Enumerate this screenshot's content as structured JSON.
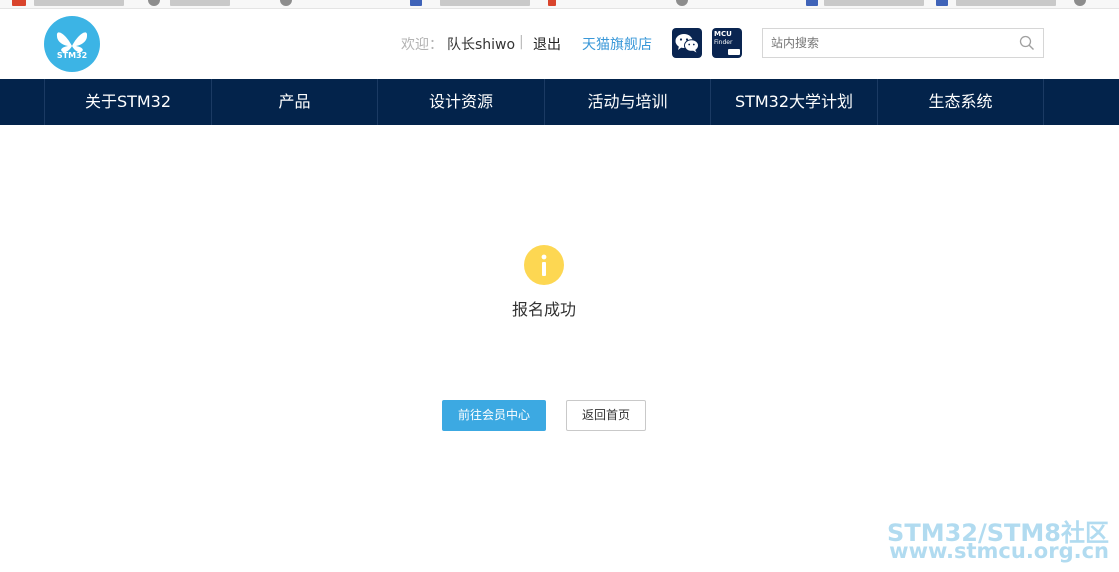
{
  "header": {
    "logo_text": "STM32",
    "welcome_label": "欢迎：",
    "username": "队长shiwo",
    "separator": "|",
    "logout_label": "退出",
    "tmall_label": "天猫旗舰店",
    "mcu_finder": {
      "line1": "MCU",
      "line2": "Finder"
    },
    "search": {
      "placeholder": "站内搜索",
      "value": ""
    }
  },
  "nav": {
    "items": [
      {
        "label": "关于STM32"
      },
      {
        "label": "产品"
      },
      {
        "label": "设计资源"
      },
      {
        "label": "活动与培训"
      },
      {
        "label": "STM32大学计划"
      },
      {
        "label": "生态系统"
      }
    ]
  },
  "main": {
    "message": "报名成功",
    "primary_button": "前往会员中心",
    "secondary_button": "返回首页"
  },
  "watermark": {
    "line1": "STM32/STM8社区",
    "line2": "www.stmcu.org.cn"
  },
  "colors": {
    "brand_blue": "#3cb4e5",
    "nav_bg": "#03234b",
    "primary_btn": "#3ca9e2",
    "info_yellow": "#fdd752",
    "tmall_link": "#3a98d8"
  }
}
